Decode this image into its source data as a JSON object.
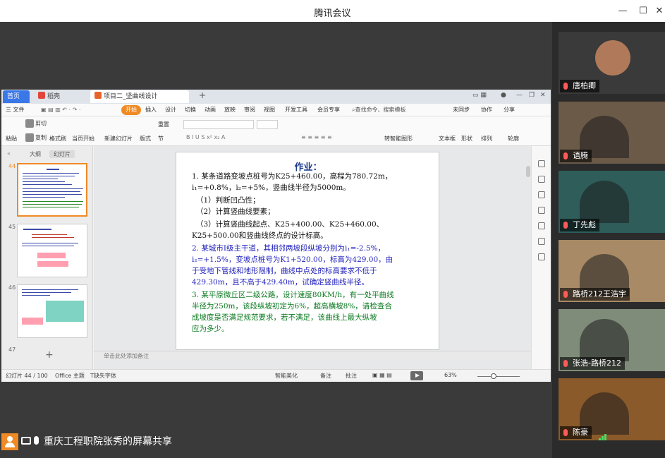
{
  "window": {
    "title": "腾讯会议"
  },
  "wps": {
    "tabs": {
      "home": "首页",
      "daoke": "稻壳",
      "file": "项目二_坚曲线设计1.ppt"
    },
    "menus": [
      "三 文件",
      "开始",
      "插入",
      "设计",
      "切换",
      "动画",
      "放映",
      "审阅",
      "视图",
      "开发工具",
      "会员专享"
    ],
    "search": "查找命令、搜索模板",
    "topright": [
      "未同步",
      "协作",
      "分享"
    ],
    "ribbon": {
      "paste": "粘贴",
      "cut": "剪切",
      "copy": "复制",
      "format_painter": "格式刷",
      "from_current": "当页开始",
      "new_slide": "新建幻灯片",
      "layout": "版式",
      "section": "节",
      "reset": "重置",
      "textbox": "文本框",
      "shape": "形状",
      "arrange": "排列",
      "outline": "轮廓",
      "convert_to_smartart": "转智能图形"
    },
    "left_tabs": {
      "outline": "大纲",
      "slides": "幻灯片"
    },
    "slide_numbers": [
      "44",
      "45",
      "46",
      "47"
    ],
    "notes_placeholder": "单击此处添加备注",
    "status": {
      "slide_info": "幻灯片 44 / 100",
      "theme": "Office 主题",
      "missing_font": "缺失字体",
      "smart_beautify": "智能美化",
      "notes": "备注",
      "comments": "批注",
      "zoom": "63%"
    }
  },
  "slide": {
    "title": "作业：",
    "lines": [
      {
        "text": "1. 某条道路变坡点桩号为K25+460.00，高程为780.72m，",
        "color": "k"
      },
      {
        "text": "   i₁=+0.8%，i₂=+5%，竖曲线半径为5000m。",
        "color": "k"
      },
      {
        "text": "（1）判断凹凸性；",
        "color": "k"
      },
      {
        "text": "（2）计算竖曲线要素；",
        "color": "k"
      },
      {
        "text": "（3）计算竖曲线起点、K25+400.00、K25+460.00、",
        "color": "k"
      },
      {
        "text": "   K25+500.00和竖曲线终点的设计标高。",
        "color": "k"
      },
      {
        "text": "2. 某城市Ⅰ级主干道，其相邻两坡段纵坡分别为i₁=-2.5%，",
        "color": "b"
      },
      {
        "text": "   i₂=+1.5%，变坡点桩号为K1+520.00，标高为429.00，由",
        "color": "b"
      },
      {
        "text": "   于受地下管线和地形限制，曲线中点处的标高要求不低于",
        "color": "b"
      },
      {
        "text": "   429.30m，且不高于429.40m，试确定竖曲线半径。",
        "color": "b"
      },
      {
        "text": "3. 某平原微丘区二级公路，设计速度80KM/h，有一处平曲线",
        "color": "g"
      },
      {
        "text": "   半径为250m，该段纵坡初定为6%，超高横坡8%，请检查合",
        "color": "g"
      },
      {
        "text": "   成坡度是否满足规范要求，若不满足，该曲线上最大纵坡",
        "color": "g"
      },
      {
        "text": "   应为多少。",
        "color": "g"
      }
    ]
  },
  "share_label": "重庆工程职院张秀的屏幕共享",
  "participants": [
    {
      "name": "唐柏卿",
      "bg": "#3a3a3a"
    },
    {
      "name": "语腾",
      "bg": "#6b5a48"
    },
    {
      "name": "丁先彪",
      "bg": "#2e5d5a"
    },
    {
      "name": "路桥212王浩宇",
      "bg": "#a88a66"
    },
    {
      "name": "张浩-路桥212",
      "bg": "#7f8c7a"
    },
    {
      "name": "陈豪",
      "bg": "#8a5a2a"
    }
  ]
}
